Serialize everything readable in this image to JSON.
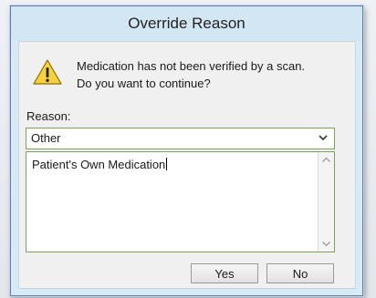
{
  "dialog": {
    "title": "Override Reason",
    "message_line1": "Medication has not been verified by a scan.",
    "message_line2": "Do you want to continue?",
    "icon": "warning-icon"
  },
  "reason": {
    "label": "Reason:",
    "selected": "Other"
  },
  "comment": {
    "value": "Patient's Own Medication"
  },
  "buttons": {
    "yes": "Yes",
    "no": "No"
  },
  "colors": {
    "title_bar": "#d2e6f4",
    "field_border": "#7aa35a",
    "warning_fill": "#f7d23e"
  }
}
